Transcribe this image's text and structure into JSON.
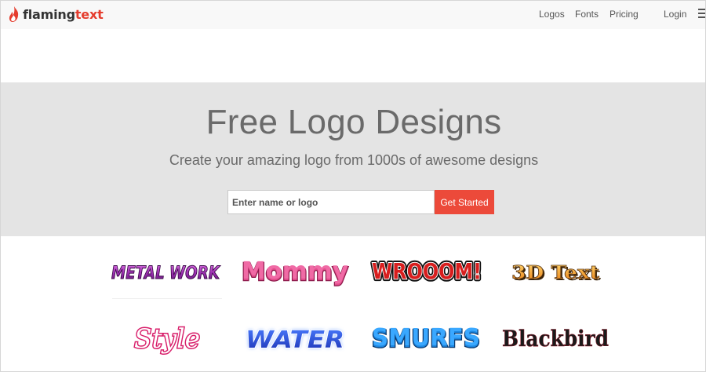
{
  "brand": {
    "name_part1": "flaming",
    "name_part2": "text",
    "accent_color": "#e53d2e"
  },
  "nav": {
    "links": [
      {
        "label": "Logos"
      },
      {
        "label": "Fonts"
      },
      {
        "label": "Pricing"
      },
      {
        "label": "Login"
      }
    ],
    "menu_icon": "hamburger-icon"
  },
  "hero": {
    "title": "Free Logo Designs",
    "subtitle": "Create your amazing logo from 1000s of awesome designs",
    "search": {
      "placeholder": "Enter name or logo",
      "value": ""
    },
    "cta_label": "Get Started",
    "cta_color": "#ec4a3a"
  },
  "samples": [
    {
      "text": "METAL WORK"
    },
    {
      "text": "Mommy"
    },
    {
      "text": "WROOOM!"
    },
    {
      "text": "3D Text"
    },
    {
      "text": "Style"
    },
    {
      "text": "WATER"
    },
    {
      "text": "SMURFS"
    },
    {
      "text": "Blackbird"
    }
  ]
}
